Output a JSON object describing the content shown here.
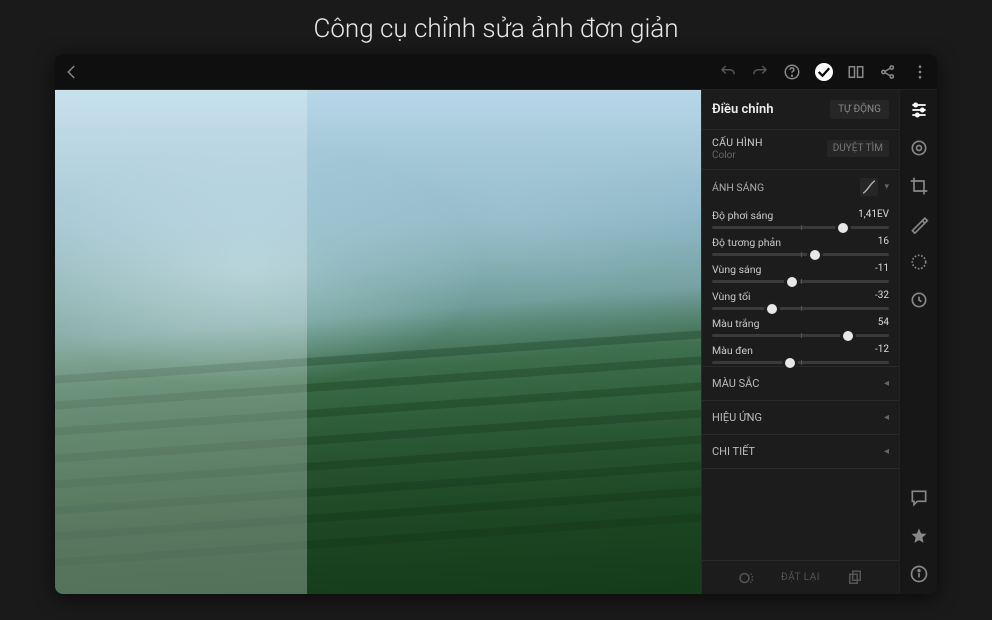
{
  "page_heading": "Công cụ chỉnh sửa ảnh đơn giản",
  "panel": {
    "title": "Điều chỉnh",
    "auto": "TỰ ĐỘNG",
    "profile": {
      "label": "CẤU HÌNH",
      "value": "Color",
      "browse": "DUYỆT TÌM"
    },
    "light_section": "ÁNH SÁNG",
    "sliders": {
      "exposure": {
        "label": "Độ phơi sáng",
        "display": "1,41EV",
        "pos": 74
      },
      "contrast": {
        "label": "Độ tương phản",
        "display": "16",
        "pos": 58
      },
      "highlights": {
        "label": "Vùng sáng",
        "display": "-11",
        "pos": 45
      },
      "shadows": {
        "label": "Vùng tối",
        "display": "-32",
        "pos": 34
      },
      "whites": {
        "label": "Màu trắng",
        "display": "54",
        "pos": 77
      },
      "blacks": {
        "label": "Màu đen",
        "display": "-12",
        "pos": 44
      }
    },
    "collapsed": {
      "color": "MÀU SẮC",
      "effects": "HIỆU ỨNG",
      "detail": "CHI TIẾT"
    },
    "reset": "ĐẶT LẠI"
  }
}
